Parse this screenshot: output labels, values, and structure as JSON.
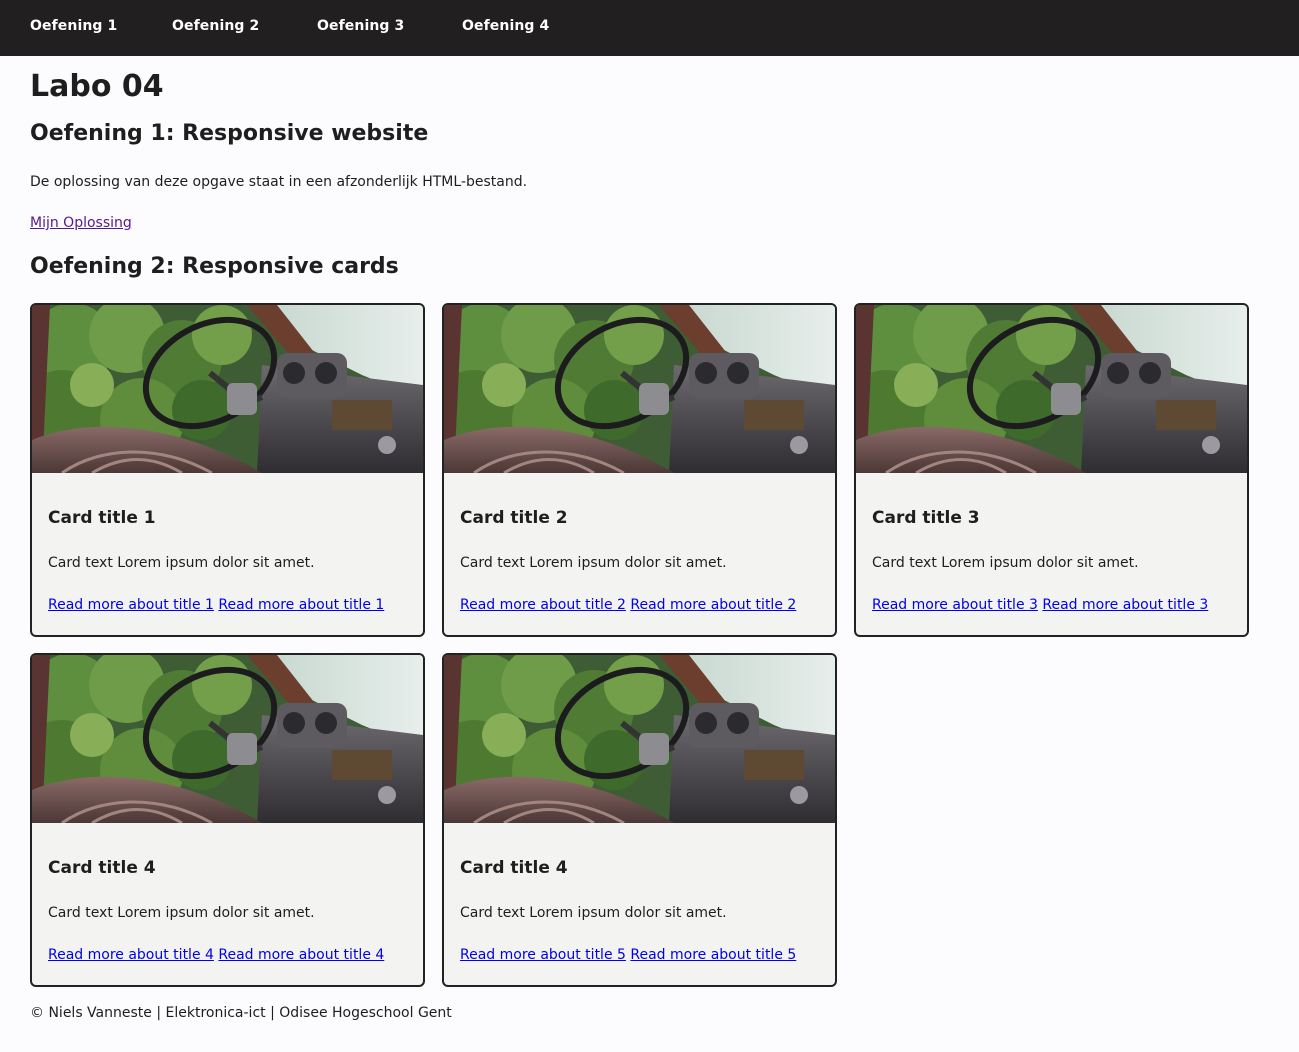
{
  "nav": {
    "items": [
      {
        "label": "Oefening 1"
      },
      {
        "label": "Oefening 2"
      },
      {
        "label": "Oefening 3"
      },
      {
        "label": "Oefening 4"
      }
    ]
  },
  "page": {
    "title": "Labo 04",
    "section1": {
      "heading": "Oefening 1: Responsive website",
      "text": "De oplossing van deze opgave staat in een afzonderlijk HTML-bestand.",
      "link": "Mijn Oplossing"
    },
    "section2": {
      "heading": "Oefening 2: Responsive cards"
    }
  },
  "cards": [
    {
      "title": "Card title 1",
      "text": "Card text Lorem ipsum dolor sit amet.",
      "link1": "Read more about title 1",
      "link2": "Read more about title 1"
    },
    {
      "title": "Card title 2",
      "text": "Card text Lorem ipsum dolor sit amet.",
      "link1": "Read more about title 2",
      "link2": "Read more about title 2"
    },
    {
      "title": "Card title 3",
      "text": "Card text Lorem ipsum dolor sit amet.",
      "link1": "Read more about title 3",
      "link2": "Read more about title 3"
    },
    {
      "title": "Card title 4",
      "text": "Card text Lorem ipsum dolor sit amet.",
      "link1": "Read more about title 4",
      "link2": "Read more about title 4"
    },
    {
      "title": "Card title 4",
      "text": "Card text Lorem ipsum dolor sit amet.",
      "link1": "Read more about title 5",
      "link2": "Read more about title 5"
    }
  ],
  "footer": {
    "text": "© Niels Vanneste | Elektronica-ict | Odisee Hogeschool Gent"
  },
  "colors": {
    "nav_bg": "#221f20",
    "page_bg": "#fcfbfd",
    "card_bg": "#f3f3f2",
    "link": "#0000ee",
    "visited_link": "#551a8b"
  }
}
